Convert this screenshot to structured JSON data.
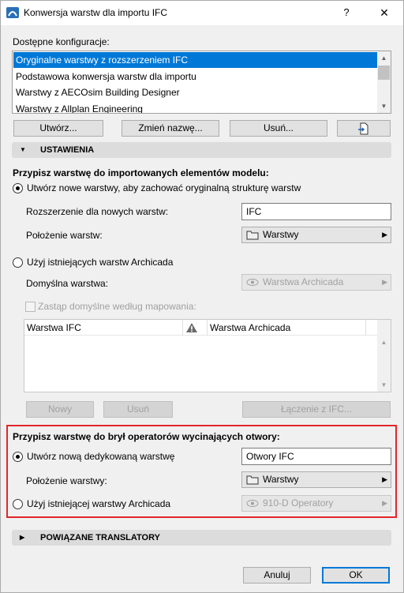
{
  "window": {
    "title": "Konwersja warstw dla importu IFC",
    "help_label": "?",
    "close_label": "✕"
  },
  "configs": {
    "label": "Dostępne konfiguracje:",
    "items": [
      "Oryginalne warstwy z rozszerzeniem IFC",
      "Podstawowa konwersja warstw dla importu",
      "Warstwy z AECOsim Building Designer",
      "Warstwy z Allplan Engineering"
    ],
    "selected_index": 0
  },
  "buttons": {
    "create": "Utwórz...",
    "rename": "Zmień nazwę...",
    "delete": "Usuń..."
  },
  "settings": {
    "header": "USTAWIENIA",
    "import_title": "Przypisz warstwę do importowanych elementów modelu:",
    "create_new_label": "Utwórz nowe warstwy, aby zachować oryginalną strukturę warstw",
    "extension_label": "Rozszerzenie dla nowych warstw:",
    "extension_value": "IFC",
    "position_label": "Położenie warstw:",
    "position_value": "Warstwy",
    "use_existing_label": "Użyj istniejących warstw Archicada",
    "default_layer_label": "Domyślna warstwa:",
    "default_layer_value": "Warstwa Archicada",
    "replace_label": "Zastąp domyślne według mapowania:",
    "table": {
      "col1": "Warstwa IFC",
      "col3": "Warstwa Archicada"
    },
    "new_btn": "Nowy",
    "delete_btn": "Usuń",
    "merge_btn": "Łączenie z IFC..."
  },
  "openings": {
    "title": "Przypisz warstwę do brył operatorów wycinających otwory:",
    "create_label": "Utwórz nową dedykowaną warstwę",
    "create_value": "Otwory IFC",
    "position_label": "Położenie warstwy:",
    "position_value": "Warstwy",
    "use_existing_label": "Użyj istniejącej warstwy Archicada",
    "existing_value": "910-D Operatory"
  },
  "translators": {
    "header": "POWIĄZANE TRANSLATORY"
  },
  "footer": {
    "cancel": "Anuluj",
    "ok": "OK"
  },
  "colors": {
    "selection": "#0078d7",
    "highlight": "#e2262b"
  }
}
